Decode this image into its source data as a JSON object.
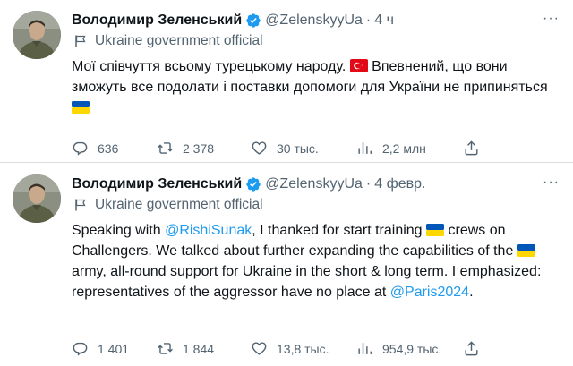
{
  "tweets": [
    {
      "author_name": "Володимир Зеленський",
      "handle": "@ZelenskyyUa",
      "separator": "·",
      "time": "4 ч",
      "affiliation": "Ukraine government official",
      "text_part1": "Мої співчуття всьому турецькому народу.",
      "text_part2": "Впевнений, що вони зможуть все подолати і поставки допомоги для України не припиняться",
      "replies": "636",
      "retweets": "2 378",
      "likes": "30 тыс.",
      "views": "2,2 млн"
    },
    {
      "author_name": "Володимир Зеленський",
      "handle": "@ZelenskyyUa",
      "separator": "·",
      "time": "4 февр.",
      "affiliation": "Ukraine government official",
      "text_part1": "Speaking with",
      "mention1": "@RishiSunak",
      "text_part2": ", I thanked for start training",
      "text_part3": "crews on Challengers. We talked about further expanding the capabilities of the",
      "text_part4": "army, all-round support for Ukraine in the short & long term. I emphasized: representatives of the aggressor have no place at",
      "mention2": "@Paris2024",
      "text_part5": ".",
      "replies": "1 401",
      "retweets": "1 844",
      "likes": "13,8 тыс.",
      "views": "954,9 тыс."
    }
  ],
  "icons": {
    "verified": "verified-badge-icon",
    "affiliation": "government-flag-icon",
    "reply": "reply-icon",
    "retweet": "retweet-icon",
    "like": "heart-icon",
    "views": "views-chart-icon",
    "share": "share-icon",
    "flag_turkey": "turkey-flag-emoji",
    "flag_ukraine": "ukraine-flag-emoji"
  },
  "colors": {
    "accent": "#1d9bf0",
    "secondary_text": "#536471",
    "primary_text": "#0f1419",
    "verified": "#1d9bf0",
    "turkey_red": "#e30a17",
    "ukraine_blue": "#0057b7",
    "ukraine_yellow": "#ffd700"
  }
}
